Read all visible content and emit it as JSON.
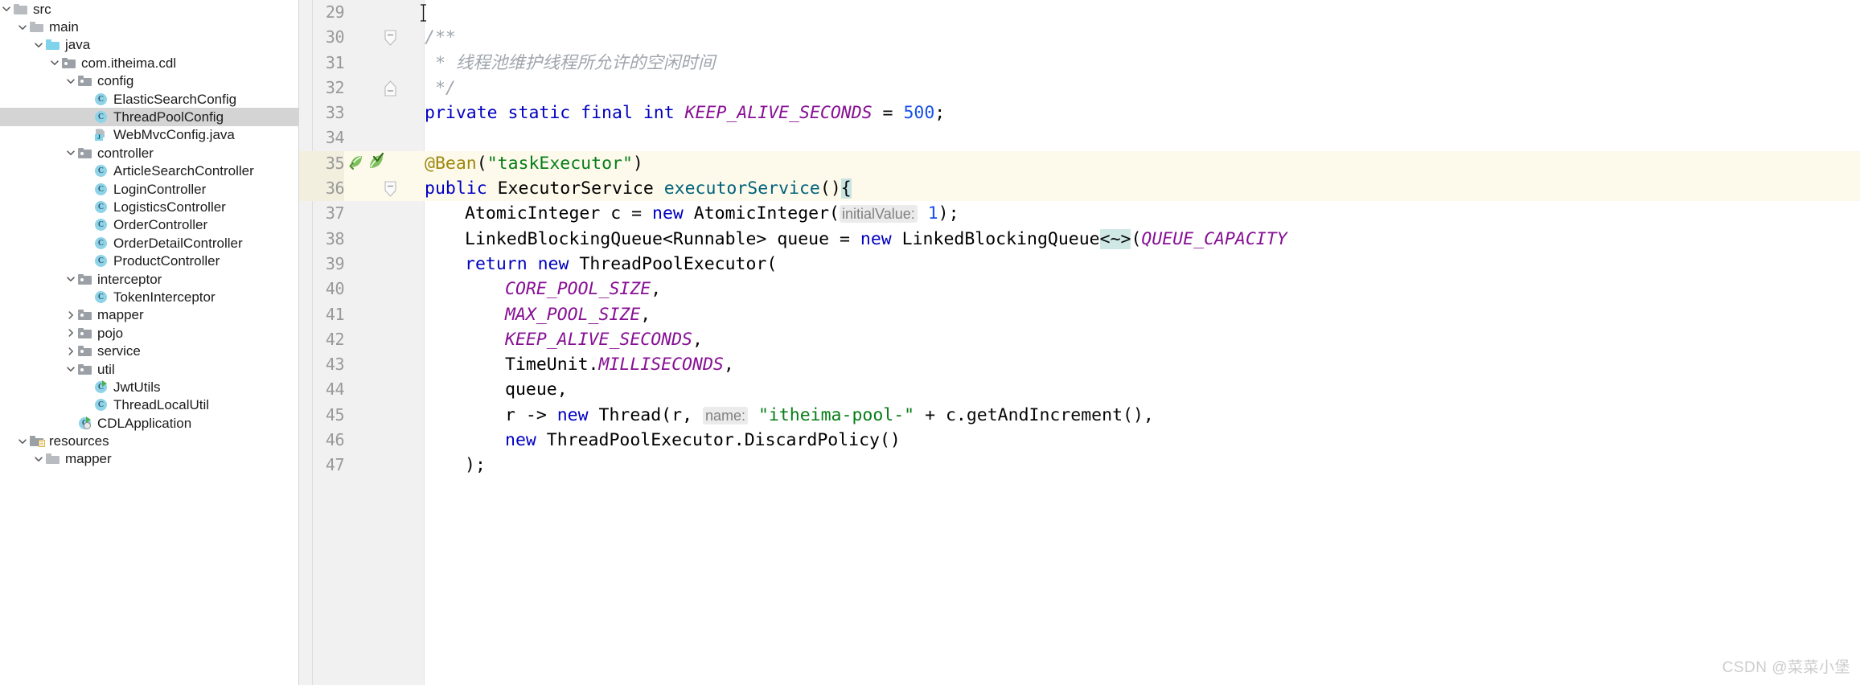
{
  "project_tree": {
    "name": "project-file-tree",
    "items": [
      {
        "label": "src",
        "indent": 0,
        "twisty": "down",
        "icon": "folder-plain",
        "selected": false
      },
      {
        "label": "main",
        "indent": 1,
        "twisty": "down",
        "icon": "folder-plain",
        "selected": false
      },
      {
        "label": "java",
        "indent": 2,
        "twisty": "down",
        "icon": "folder-blue",
        "selected": false
      },
      {
        "label": "com.itheima.cdl",
        "indent": 3,
        "twisty": "down",
        "icon": "folder-package",
        "selected": false
      },
      {
        "label": "config",
        "indent": 4,
        "twisty": "down",
        "icon": "folder-package",
        "selected": false
      },
      {
        "label": "ElasticSearchConfig",
        "indent": 5,
        "twisty": "none",
        "icon": "class",
        "selected": false
      },
      {
        "label": "ThreadPoolConfig",
        "indent": 5,
        "twisty": "none",
        "icon": "class",
        "selected": true
      },
      {
        "label": "WebMvcConfig.java",
        "indent": 5,
        "twisty": "none",
        "icon": "java-file",
        "selected": false
      },
      {
        "label": "controller",
        "indent": 4,
        "twisty": "down",
        "icon": "folder-package",
        "selected": false
      },
      {
        "label": "ArticleSearchController",
        "indent": 5,
        "twisty": "none",
        "icon": "class",
        "selected": false
      },
      {
        "label": "LoginController",
        "indent": 5,
        "twisty": "none",
        "icon": "class",
        "selected": false
      },
      {
        "label": "LogisticsController",
        "indent": 5,
        "twisty": "none",
        "icon": "class",
        "selected": false
      },
      {
        "label": "OrderController",
        "indent": 5,
        "twisty": "none",
        "icon": "class",
        "selected": false
      },
      {
        "label": "OrderDetailController",
        "indent": 5,
        "twisty": "none",
        "icon": "class",
        "selected": false
      },
      {
        "label": "ProductController",
        "indent": 5,
        "twisty": "none",
        "icon": "class",
        "selected": false
      },
      {
        "label": "interceptor",
        "indent": 4,
        "twisty": "down",
        "icon": "folder-package",
        "selected": false
      },
      {
        "label": "TokenInterceptor",
        "indent": 5,
        "twisty": "none",
        "icon": "class",
        "selected": false
      },
      {
        "label": "mapper",
        "indent": 4,
        "twisty": "right",
        "icon": "folder-package",
        "selected": false
      },
      {
        "label": "pojo",
        "indent": 4,
        "twisty": "right",
        "icon": "folder-package",
        "selected": false
      },
      {
        "label": "service",
        "indent": 4,
        "twisty": "right",
        "icon": "folder-package",
        "selected": false
      },
      {
        "label": "util",
        "indent": 4,
        "twisty": "down",
        "icon": "folder-package",
        "selected": false
      },
      {
        "label": "JwtUtils",
        "indent": 5,
        "twisty": "none",
        "icon": "class-runnable",
        "selected": false
      },
      {
        "label": "ThreadLocalUtil",
        "indent": 5,
        "twisty": "none",
        "icon": "class",
        "selected": false
      },
      {
        "label": "CDLApplication",
        "indent": 4,
        "twisty": "none",
        "icon": "class-spring",
        "selected": false
      },
      {
        "label": "resources",
        "indent": 1,
        "twisty": "down",
        "icon": "folder-resources",
        "selected": false
      },
      {
        "label": "mapper",
        "indent": 2,
        "twisty": "down",
        "icon": "folder-plain",
        "selected": false
      }
    ]
  },
  "editor": {
    "name": "java-code-editor",
    "file": "ThreadPoolConfig",
    "highlighted_lines": [
      35,
      36
    ],
    "caret_line": 36,
    "lines": [
      {
        "num": "29",
        "fold": "none",
        "icons": [],
        "indent": 0,
        "tokens": []
      },
      {
        "num": "30",
        "fold": "start",
        "icons": [],
        "indent": 0,
        "tokens": [
          {
            "t": "cmt",
            "v": "/**"
          }
        ]
      },
      {
        "num": "31",
        "fold": "none",
        "icons": [],
        "indent": 0,
        "tokens": [
          {
            "t": "cmt",
            "v": " * 线程池维护线程所允许的空闲时间"
          }
        ]
      },
      {
        "num": "32",
        "fold": "end",
        "icons": [],
        "indent": 0,
        "tokens": [
          {
            "t": "cmt",
            "v": " */"
          }
        ]
      },
      {
        "num": "33",
        "fold": "none",
        "icons": [],
        "indent": 0,
        "tokens": [
          {
            "t": "kw",
            "v": "private static final int "
          },
          {
            "t": "fld",
            "v": "KEEP_ALIVE_SECONDS"
          },
          {
            "t": "plain",
            "v": " = "
          },
          {
            "t": "num",
            "v": "500"
          },
          {
            "t": "plain",
            "v": ";"
          }
        ]
      },
      {
        "num": "34",
        "fold": "none",
        "icons": [],
        "indent": 0,
        "tokens": []
      },
      {
        "num": "35",
        "fold": "none",
        "icons": [
          "bean-icon",
          "spring-bean-check-icon"
        ],
        "indent": 0,
        "tokens": [
          {
            "t": "ann",
            "v": "@Bean"
          },
          {
            "t": "plain",
            "v": "("
          },
          {
            "t": "str",
            "v": "\"taskExecutor\""
          },
          {
            "t": "plain",
            "v": ")"
          }
        ]
      },
      {
        "num": "36",
        "fold": "start",
        "icons": [],
        "indent": 0,
        "tokens": [
          {
            "t": "kw",
            "v": "public "
          },
          {
            "t": "typ",
            "v": "ExecutorService "
          },
          {
            "t": "mth",
            "v": "executorService"
          },
          {
            "t": "plain",
            "v": "()"
          },
          {
            "t": "caret",
            "v": "{"
          }
        ]
      },
      {
        "num": "37",
        "fold": "none",
        "icons": [],
        "indent": 1,
        "tokens": [
          {
            "t": "typ",
            "v": "AtomicInteger c = "
          },
          {
            "t": "kw",
            "v": "new "
          },
          {
            "t": "typ",
            "v": "AtomicInteger("
          },
          {
            "t": "hint",
            "v": "initialValue:"
          },
          {
            "t": "plain",
            "v": " "
          },
          {
            "t": "num",
            "v": "1"
          },
          {
            "t": "plain",
            "v": ");"
          }
        ]
      },
      {
        "num": "38",
        "fold": "none",
        "icons": [],
        "indent": 1,
        "tokens": [
          {
            "t": "typ",
            "v": "LinkedBlockingQueue<Runnable> queue = "
          },
          {
            "t": "kw",
            "v": "new "
          },
          {
            "t": "typ",
            "v": "LinkedBlockingQueue"
          },
          {
            "t": "sel",
            "v": "<~>"
          },
          {
            "t": "plain",
            "v": "("
          },
          {
            "t": "fld",
            "v": "QUEUE_CAPACITY"
          }
        ]
      },
      {
        "num": "39",
        "fold": "none",
        "icons": [],
        "indent": 1,
        "tokens": [
          {
            "t": "kw",
            "v": "return new "
          },
          {
            "t": "typ",
            "v": "ThreadPoolExecutor("
          }
        ]
      },
      {
        "num": "40",
        "fold": "none",
        "icons": [],
        "indent": 2,
        "tokens": [
          {
            "t": "fld",
            "v": "CORE_POOL_SIZE"
          },
          {
            "t": "plain",
            "v": ","
          }
        ]
      },
      {
        "num": "41",
        "fold": "none",
        "icons": [],
        "indent": 2,
        "tokens": [
          {
            "t": "fld",
            "v": "MAX_POOL_SIZE"
          },
          {
            "t": "plain",
            "v": ","
          }
        ]
      },
      {
        "num": "42",
        "fold": "none",
        "icons": [],
        "indent": 2,
        "tokens": [
          {
            "t": "fld",
            "v": "KEEP_ALIVE_SECONDS"
          },
          {
            "t": "plain",
            "v": ","
          }
        ]
      },
      {
        "num": "43",
        "fold": "none",
        "icons": [],
        "indent": 2,
        "tokens": [
          {
            "t": "typ",
            "v": "TimeUnit."
          },
          {
            "t": "fld",
            "v": "MILLISECONDS"
          },
          {
            "t": "plain",
            "v": ","
          }
        ]
      },
      {
        "num": "44",
        "fold": "none",
        "icons": [],
        "indent": 2,
        "tokens": [
          {
            "t": "typ",
            "v": "queue,"
          }
        ]
      },
      {
        "num": "45",
        "fold": "none",
        "icons": [],
        "indent": 2,
        "tokens": [
          {
            "t": "typ",
            "v": "r -> "
          },
          {
            "t": "kw",
            "v": "new "
          },
          {
            "t": "typ",
            "v": "Thread(r, "
          },
          {
            "t": "hint",
            "v": "name:"
          },
          {
            "t": "plain",
            "v": " "
          },
          {
            "t": "str",
            "v": "\"itheima-pool-\""
          },
          {
            "t": "plain",
            "v": " + c.getAndIncrement(),"
          }
        ]
      },
      {
        "num": "46",
        "fold": "none",
        "icons": [],
        "indent": 2,
        "tokens": [
          {
            "t": "kw",
            "v": "new "
          },
          {
            "t": "typ",
            "v": "ThreadPoolExecutor.DiscardPolicy()"
          }
        ]
      },
      {
        "num": "47",
        "fold": "none",
        "icons": [],
        "indent": 1,
        "tokens": [
          {
            "t": "plain",
            "v": ");"
          }
        ]
      }
    ]
  },
  "watermark": {
    "text": "CSDN @菜菜小堡"
  },
  "colors": {
    "selection_row": "#d4d4d4",
    "gutter_bg": "#f1f1f1",
    "line_highlight": "#fdfaec",
    "keyword": "#0000c0",
    "comment": "#a0a6ad",
    "string": "#067d17",
    "number": "#1750eb",
    "annotation": "#9e880d",
    "field": "#871094",
    "method": "#00627a",
    "class_icon": "#8fd3e8",
    "folder_icon": "#9aa0a6",
    "folder_blue": "#7fd3ea"
  }
}
